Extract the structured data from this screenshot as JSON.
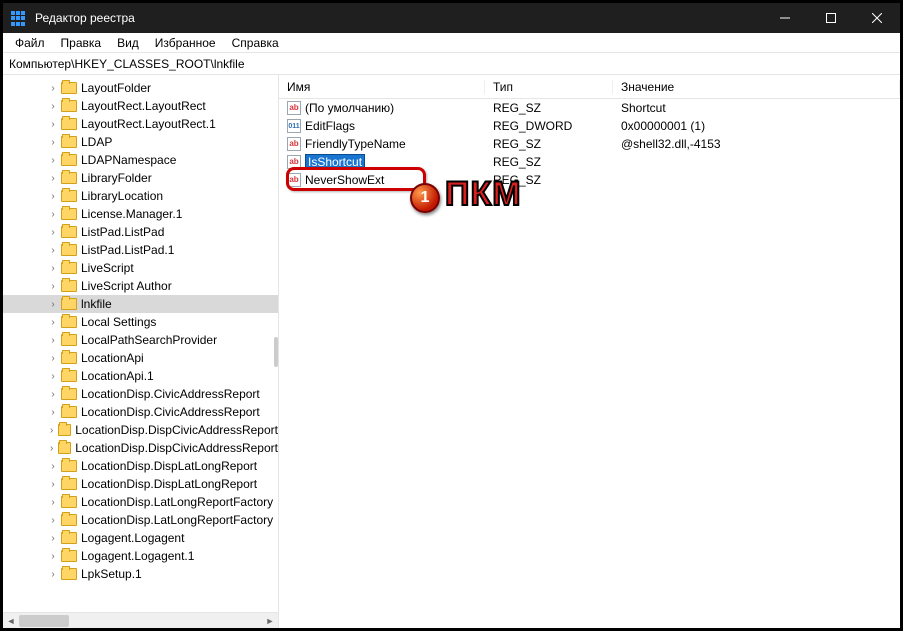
{
  "title": "Редактор реестра",
  "menus": [
    "Файл",
    "Правка",
    "Вид",
    "Избранное",
    "Справка"
  ],
  "address": "Компьютер\\HKEY_CLASSES_ROOT\\lnkfile",
  "tree": [
    {
      "label": "LayoutFolder"
    },
    {
      "label": "LayoutRect.LayoutRect"
    },
    {
      "label": "LayoutRect.LayoutRect.1"
    },
    {
      "label": "LDAP"
    },
    {
      "label": "LDAPNamespace"
    },
    {
      "label": "LibraryFolder"
    },
    {
      "label": "LibraryLocation"
    },
    {
      "label": "License.Manager.1"
    },
    {
      "label": "ListPad.ListPad"
    },
    {
      "label": "ListPad.ListPad.1"
    },
    {
      "label": "LiveScript"
    },
    {
      "label": "LiveScript Author"
    },
    {
      "label": "lnkfile",
      "selected": true
    },
    {
      "label": "Local Settings"
    },
    {
      "label": "LocalPathSearchProvider"
    },
    {
      "label": "LocationApi"
    },
    {
      "label": "LocationApi.1"
    },
    {
      "label": "LocationDisp.CivicAddressReport"
    },
    {
      "label": "LocationDisp.CivicAddressReport"
    },
    {
      "label": "LocationDisp.DispCivicAddressReport"
    },
    {
      "label": "LocationDisp.DispCivicAddressReport"
    },
    {
      "label": "LocationDisp.DispLatLongReport"
    },
    {
      "label": "LocationDisp.DispLatLongReport"
    },
    {
      "label": "LocationDisp.LatLongReportFactory"
    },
    {
      "label": "LocationDisp.LatLongReportFactory"
    },
    {
      "label": "Logagent.Logagent"
    },
    {
      "label": "Logagent.Logagent.1"
    },
    {
      "label": "LpkSetup.1"
    }
  ],
  "columns": {
    "name": "Имя",
    "type": "Тип",
    "value": "Значение"
  },
  "values": [
    {
      "icon": "ab",
      "name": "(По умолчанию)",
      "type": "REG_SZ",
      "value": "Shortcut"
    },
    {
      "icon": "dw",
      "name": "EditFlags",
      "type": "REG_DWORD",
      "value": "0x00000001 (1)"
    },
    {
      "icon": "ab",
      "name": "FriendlyTypeName",
      "type": "REG_SZ",
      "value": "@shell32.dll,-4153"
    },
    {
      "icon": "ab",
      "name": "IsShortcut",
      "type": "REG_SZ",
      "value": "",
      "editing": true
    },
    {
      "icon": "ab",
      "name": "NeverShowExt",
      "type": "REG_SZ",
      "value": ""
    }
  ],
  "annotation": {
    "badge": "1",
    "text": "ПКМ"
  }
}
